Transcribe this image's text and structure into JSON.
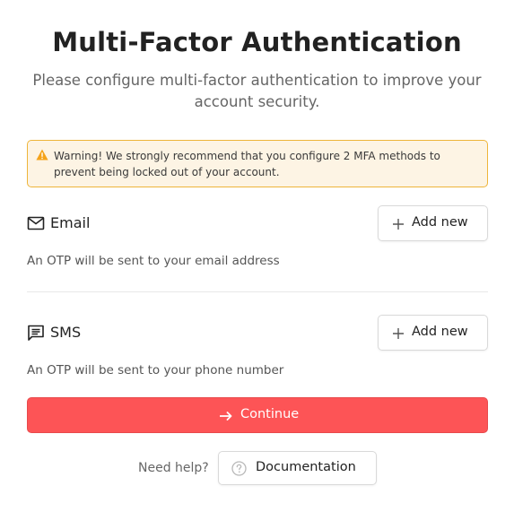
{
  "header": {
    "title": "Multi-Factor Authentication",
    "subtitle": "Please configure multi-factor authentication to improve your account security."
  },
  "warning": {
    "icon": "warning-triangle-icon",
    "text": "Warning! We strongly recommend that you configure 2 MFA methods to prevent being locked out of your account.",
    "accent_color": "#eeb53a"
  },
  "methods": [
    {
      "icon": "mail-icon",
      "label": "Email",
      "button_label": "Add new",
      "description": "An OTP will be sent to your email address"
    },
    {
      "icon": "sms-icon",
      "label": "SMS",
      "button_label": "Add new",
      "description": "An OTP will be sent to your phone number"
    }
  ],
  "continue": {
    "label": "Continue",
    "icon": "arrow-right-icon",
    "color": "#fd5456"
  },
  "help": {
    "label": "Need help?",
    "button_label": "Documentation",
    "icon": "help-circle-icon"
  }
}
